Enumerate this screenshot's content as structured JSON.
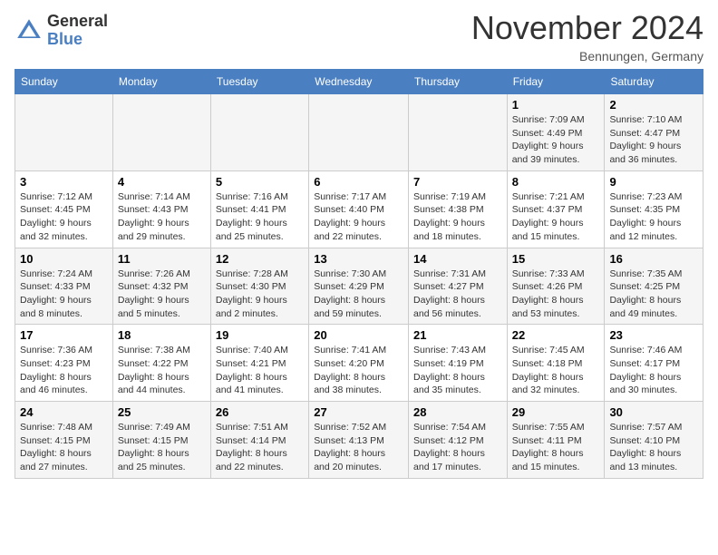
{
  "logo": {
    "general": "General",
    "blue": "Blue"
  },
  "title": "November 2024",
  "location": "Bennungen, Germany",
  "days_header": [
    "Sunday",
    "Monday",
    "Tuesday",
    "Wednesday",
    "Thursday",
    "Friday",
    "Saturday"
  ],
  "weeks": [
    {
      "cells": [
        {
          "day": "",
          "info": ""
        },
        {
          "day": "",
          "info": ""
        },
        {
          "day": "",
          "info": ""
        },
        {
          "day": "",
          "info": ""
        },
        {
          "day": "",
          "info": ""
        },
        {
          "day": "1",
          "info": "Sunrise: 7:09 AM\nSunset: 4:49 PM\nDaylight: 9 hours and 39 minutes."
        },
        {
          "day": "2",
          "info": "Sunrise: 7:10 AM\nSunset: 4:47 PM\nDaylight: 9 hours and 36 minutes."
        }
      ]
    },
    {
      "cells": [
        {
          "day": "3",
          "info": "Sunrise: 7:12 AM\nSunset: 4:45 PM\nDaylight: 9 hours and 32 minutes."
        },
        {
          "day": "4",
          "info": "Sunrise: 7:14 AM\nSunset: 4:43 PM\nDaylight: 9 hours and 29 minutes."
        },
        {
          "day": "5",
          "info": "Sunrise: 7:16 AM\nSunset: 4:41 PM\nDaylight: 9 hours and 25 minutes."
        },
        {
          "day": "6",
          "info": "Sunrise: 7:17 AM\nSunset: 4:40 PM\nDaylight: 9 hours and 22 minutes."
        },
        {
          "day": "7",
          "info": "Sunrise: 7:19 AM\nSunset: 4:38 PM\nDaylight: 9 hours and 18 minutes."
        },
        {
          "day": "8",
          "info": "Sunrise: 7:21 AM\nSunset: 4:37 PM\nDaylight: 9 hours and 15 minutes."
        },
        {
          "day": "9",
          "info": "Sunrise: 7:23 AM\nSunset: 4:35 PM\nDaylight: 9 hours and 12 minutes."
        }
      ]
    },
    {
      "cells": [
        {
          "day": "10",
          "info": "Sunrise: 7:24 AM\nSunset: 4:33 PM\nDaylight: 9 hours and 8 minutes."
        },
        {
          "day": "11",
          "info": "Sunrise: 7:26 AM\nSunset: 4:32 PM\nDaylight: 9 hours and 5 minutes."
        },
        {
          "day": "12",
          "info": "Sunrise: 7:28 AM\nSunset: 4:30 PM\nDaylight: 9 hours and 2 minutes."
        },
        {
          "day": "13",
          "info": "Sunrise: 7:30 AM\nSunset: 4:29 PM\nDaylight: 8 hours and 59 minutes."
        },
        {
          "day": "14",
          "info": "Sunrise: 7:31 AM\nSunset: 4:27 PM\nDaylight: 8 hours and 56 minutes."
        },
        {
          "day": "15",
          "info": "Sunrise: 7:33 AM\nSunset: 4:26 PM\nDaylight: 8 hours and 53 minutes."
        },
        {
          "day": "16",
          "info": "Sunrise: 7:35 AM\nSunset: 4:25 PM\nDaylight: 8 hours and 49 minutes."
        }
      ]
    },
    {
      "cells": [
        {
          "day": "17",
          "info": "Sunrise: 7:36 AM\nSunset: 4:23 PM\nDaylight: 8 hours and 46 minutes."
        },
        {
          "day": "18",
          "info": "Sunrise: 7:38 AM\nSunset: 4:22 PM\nDaylight: 8 hours and 44 minutes."
        },
        {
          "day": "19",
          "info": "Sunrise: 7:40 AM\nSunset: 4:21 PM\nDaylight: 8 hours and 41 minutes."
        },
        {
          "day": "20",
          "info": "Sunrise: 7:41 AM\nSunset: 4:20 PM\nDaylight: 8 hours and 38 minutes."
        },
        {
          "day": "21",
          "info": "Sunrise: 7:43 AM\nSunset: 4:19 PM\nDaylight: 8 hours and 35 minutes."
        },
        {
          "day": "22",
          "info": "Sunrise: 7:45 AM\nSunset: 4:18 PM\nDaylight: 8 hours and 32 minutes."
        },
        {
          "day": "23",
          "info": "Sunrise: 7:46 AM\nSunset: 4:17 PM\nDaylight: 8 hours and 30 minutes."
        }
      ]
    },
    {
      "cells": [
        {
          "day": "24",
          "info": "Sunrise: 7:48 AM\nSunset: 4:15 PM\nDaylight: 8 hours and 27 minutes."
        },
        {
          "day": "25",
          "info": "Sunrise: 7:49 AM\nSunset: 4:15 PM\nDaylight: 8 hours and 25 minutes."
        },
        {
          "day": "26",
          "info": "Sunrise: 7:51 AM\nSunset: 4:14 PM\nDaylight: 8 hours and 22 minutes."
        },
        {
          "day": "27",
          "info": "Sunrise: 7:52 AM\nSunset: 4:13 PM\nDaylight: 8 hours and 20 minutes."
        },
        {
          "day": "28",
          "info": "Sunrise: 7:54 AM\nSunset: 4:12 PM\nDaylight: 8 hours and 17 minutes."
        },
        {
          "day": "29",
          "info": "Sunrise: 7:55 AM\nSunset: 4:11 PM\nDaylight: 8 hours and 15 minutes."
        },
        {
          "day": "30",
          "info": "Sunrise: 7:57 AM\nSunset: 4:10 PM\nDaylight: 8 hours and 13 minutes."
        }
      ]
    }
  ]
}
